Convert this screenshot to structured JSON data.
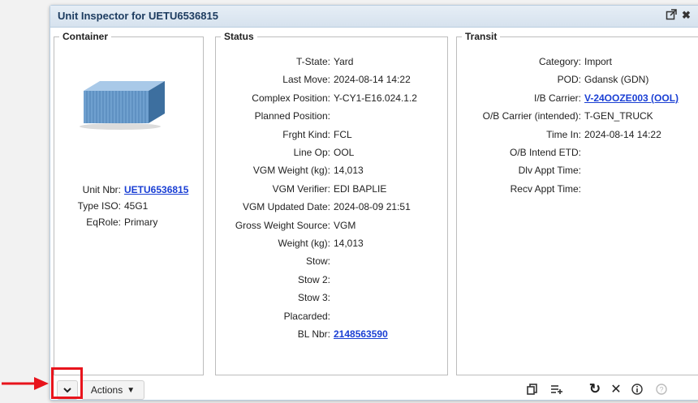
{
  "dialog": {
    "title": "Unit Inspector for UETU6536815"
  },
  "container": {
    "legend": "Container",
    "fields": [
      {
        "label": "Unit Nbr:",
        "value": "UETU6536815",
        "link": true
      },
      {
        "label": "Type ISO:",
        "value": "45G1",
        "link": false
      },
      {
        "label": "EqRole:",
        "value": "Primary",
        "link": false
      }
    ]
  },
  "status": {
    "legend": "Status",
    "fields": [
      {
        "label": "T-State:",
        "value": "Yard"
      },
      {
        "label": "Last Move:",
        "value": "2024-08-14 14:22"
      },
      {
        "label": "Complex Position:",
        "value": "Y-CY1-E16.024.1.2"
      },
      {
        "label": "Planned Position:",
        "value": ""
      },
      {
        "label": "Frght Kind:",
        "value": "FCL"
      },
      {
        "label": "Line Op:",
        "value": "OOL"
      },
      {
        "label": "VGM Weight (kg):",
        "value": "14,013"
      },
      {
        "label": "VGM Verifier:",
        "value": "EDI BAPLIE"
      },
      {
        "label": "VGM Updated Date:",
        "value": "2024-08-09 21:51"
      },
      {
        "label": "Gross Weight Source:",
        "value": "VGM"
      },
      {
        "label": "Weight (kg):",
        "value": "14,013"
      },
      {
        "label": "Stow:",
        "value": ""
      },
      {
        "label": "Stow 2:",
        "value": ""
      },
      {
        "label": "Stow 3:",
        "value": ""
      },
      {
        "label": "Placarded:",
        "value": ""
      },
      {
        "label": "BL Nbr:",
        "value": "2148563590",
        "link": true
      }
    ]
  },
  "transit": {
    "legend": "Transit",
    "fields": [
      {
        "label": "Category:",
        "value": "Import"
      },
      {
        "label": "POD:",
        "value": "Gdansk (GDN)"
      },
      {
        "label": "I/B Carrier:",
        "value": "V-24OOZE003 (OOL)",
        "link": true
      },
      {
        "label": "O/B Carrier (intended):",
        "value": "T-GEN_TRUCK"
      },
      {
        "label": "Time In:",
        "value": "2024-08-14 14:22"
      },
      {
        "label": "O/B Intend ETD:",
        "value": ""
      },
      {
        "label": "Dlv Appt Time:",
        "value": ""
      },
      {
        "label": "Recv Appt Time:",
        "value": ""
      }
    ]
  },
  "footer": {
    "actions_label": "Actions"
  },
  "colors": {
    "link": "#1a3fd4",
    "highlight": "#e8141c",
    "container_body": "#6fa0cf"
  },
  "icons": [
    "expand-icon",
    "close-icon",
    "chevron-down-icon",
    "copy-icon",
    "add-list-icon",
    "refresh-icon",
    "cancel-icon",
    "info-icon",
    "help-icon",
    "red-arrow-icon",
    "shipping-container-icon"
  ]
}
